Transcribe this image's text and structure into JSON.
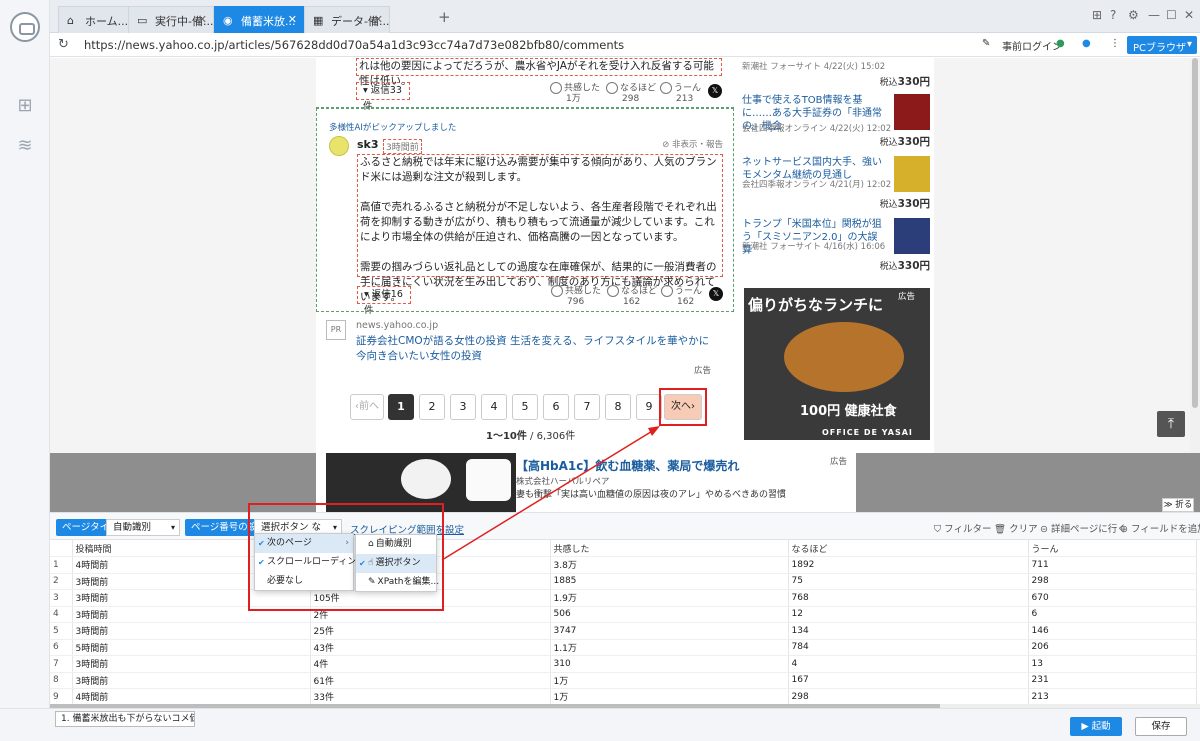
{
  "browser": {
    "tabs": [
      {
        "label": "ホーム..."
      },
      {
        "label": "実行中-備..."
      },
      {
        "label": "備蓄米放..."
      },
      {
        "label": "データ-備..."
      }
    ],
    "new_tab": "+",
    "url": "https://news.yahoo.co.jp/articles/567628dd0d70a54a1d3c93cc74a7d73e082bfb80/comments",
    "prelogin": "事前ログイン",
    "pc_browser": "PCブラウザ"
  },
  "comments": {
    "first": {
      "tail_text": "れは他の要因によってだろうが、農水省やJAがそれを受け入れ反省する可能性は低い。",
      "reply": "返信33件",
      "reactions": [
        {
          "label": "共感した",
          "count": "1万"
        },
        {
          "label": "なるほど",
          "count": "298"
        },
        {
          "label": "うーん",
          "count": "213"
        }
      ]
    },
    "second": {
      "ai_label": "多様性AIがピックアップしました",
      "user": "sk3",
      "time": "3時間前",
      "hide_report": "非表示・報告",
      "paragraphs": [
        "ふるさと納税では年末に駆け込み需要が集中する傾向があり、人気のブランド米には過剰な注文が殺到します。",
        "高値で売れるふるさと納税分が不足しないよう、各生産者段階でそれぞれ出荷を抑制する動きが広がり、積もり積もって流通量が減少しています。これにより市場全体の供給が圧迫され、価格高騰の一因となっています。",
        "需要の掴みづらい返礼品としての過度な在庫確保が、結果的に一般消費者の手に届きにくい状況を生み出しており、制度のあり方にも議論が求められています。"
      ],
      "reply": "返信16件",
      "reactions": [
        {
          "label": "共感した",
          "count": "796"
        },
        {
          "label": "なるほど",
          "count": "162"
        },
        {
          "label": "うーん",
          "count": "162"
        }
      ]
    },
    "x_icon": "𝕏"
  },
  "pr": {
    "tag": "PR",
    "source": "news.yahoo.co.jp",
    "title": "証券会社CMOが語る女性の投資 生活を変える、ライフスタイルを華やかに今向き合いたい女性の投資",
    "ad": "広告"
  },
  "pagination": {
    "prev": "‹前へ",
    "pages": [
      "1",
      "2",
      "3",
      "4",
      "5",
      "6",
      "7",
      "8",
      "9"
    ],
    "next": "次へ›",
    "count_range": "1〜10件",
    "count_total": " / 6,306件"
  },
  "right_news": [
    {
      "title": "",
      "meta": "新潮社 フォーサイト 4/22(火) 15:02",
      "price_label": "税込",
      "price": "330円"
    },
    {
      "title": "仕事で使えるTOB情報を基に……ある大手証券の「非通常の」機会",
      "meta": "会社四季報オンライン 4/22(火) 12:02",
      "price_label": "税込",
      "price": "330円"
    },
    {
      "title": "ネットサービス国内大手、強いモメンタム継続の見通し",
      "meta": "会社四季報オンライン 4/21(月) 12:02",
      "price_label": "税込",
      "price": "330円"
    },
    {
      "title": "トランプ「米国本位」関税が狙う「スミソニアン2.0」の大誤算",
      "meta": "新潮社 フォーサイト 4/16(水) 16:06",
      "price_label": "税込",
      "price": "330円"
    }
  ],
  "right_ad": {
    "ad": "広告",
    "headline": "偏りがちなランチに",
    "brand": "100円 健康社食",
    "brand2": "OFFICE DE YASAI"
  },
  "banner": {
    "ad": "広告",
    "title": "【高HbA1c】飲む血糖薬、薬局で爆売れ",
    "company": "株式会社ハーバルリペア",
    "text": "妻も衝撃「実は高い血糖値の原因は夜のアレ」やめるべきあの習慣"
  },
  "collapse": "折る",
  "toolbar": {
    "page_type_label": "ページタイプ",
    "page_type_value": "自動識別",
    "page_num_label": "ページ番号の設定",
    "page_num_value": "選択ボタン など...",
    "scrape_range": "スクレイピング範囲を設定",
    "filter": "フィルター",
    "clear": "クリア",
    "detail": "詳細ページに行く",
    "add_field": "フィールドを追加"
  },
  "table": {
    "columns": [
      "",
      "投稿時間",
      "",
      "共感した",
      "なるほど",
      "うーん"
    ],
    "rows": [
      [
        "1",
        "4時間前",
        "",
        "3.8万",
        "1892",
        "711"
      ],
      [
        "2",
        "3時間前",
        "",
        "1885",
        "75",
        "298"
      ],
      [
        "3",
        "3時間前",
        "105件",
        "1.9万",
        "768",
        "670"
      ],
      [
        "4",
        "3時間前",
        "2件",
        "506",
        "12",
        "6"
      ],
      [
        "5",
        "3時間前",
        "25件",
        "3747",
        "134",
        "146"
      ],
      [
        "6",
        "5時間前",
        "43件",
        "1.1万",
        "784",
        "206"
      ],
      [
        "7",
        "3時間前",
        "4件",
        "310",
        "4",
        "13"
      ],
      [
        "8",
        "3時間前",
        "61件",
        "1万",
        "167",
        "231"
      ],
      [
        "9",
        "4時間前",
        "33件",
        "1万",
        "298",
        "213"
      ]
    ]
  },
  "dropdown": {
    "main": [
      {
        "label": "次のページ",
        "checked": "✔"
      },
      {
        "label": "スクロールローディング",
        "checked": "✔"
      },
      {
        "label": "必要なし",
        "checked": ""
      }
    ],
    "sub": [
      {
        "label": "自動識別"
      },
      {
        "label": "選択ボタン",
        "checked": "✔"
      },
      {
        "label": "XPathを編集..."
      }
    ]
  },
  "status": {
    "task": "1. 備蓄米放出も下がらないコメ価...",
    "run": "▶ 起動",
    "save": "保存"
  },
  "colors": {
    "accent": "#1e88e5",
    "highlight_red": "#e02020",
    "next_btn_bg": "#f7cbb6"
  }
}
